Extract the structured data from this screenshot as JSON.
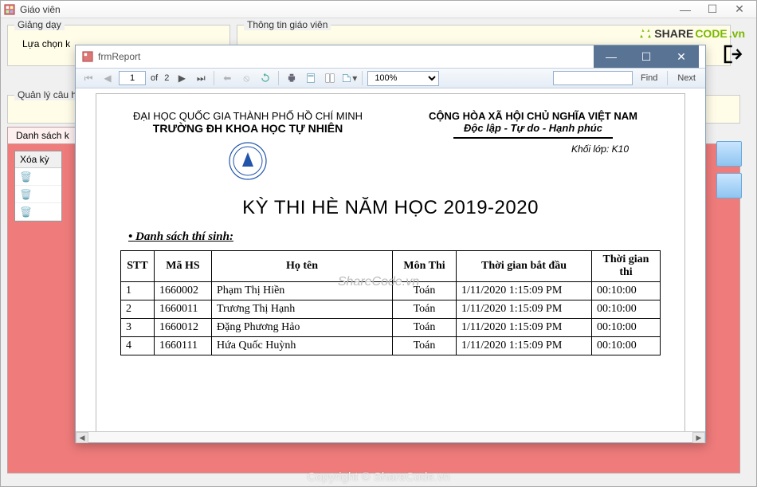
{
  "main": {
    "title": "Giáo viên",
    "group1_legend": "Giảng dạy",
    "group1_label": "Lựa chọn k",
    "group2_legend": "Thông tin giáo viên",
    "group3_legend": "Quản lý câu h",
    "tab_label": "Danh sách k",
    "grid_header": "Xóa kỳ"
  },
  "modal": {
    "title": "frmReport",
    "page_current": "1",
    "page_of": "of",
    "page_total": "2",
    "zoom": "100%",
    "find_placeholder": "",
    "find_label": "Find",
    "next_label": "Next"
  },
  "report": {
    "hdr_left_1": "ĐẠI HỌC QUỐC GIA THÀNH PHỐ HỒ CHÍ MINH",
    "hdr_left_2": "TRƯỜNG ĐH KHOA HỌC TỰ NHIÊN",
    "hdr_right_1": "CỘNG HÒA XÃ HỘI CHỦ NGHĨA VIỆT NAM",
    "hdr_right_2": "Độc lập - Tự do - Hạnh phúc",
    "hdr_right_3_label": "Khối lớp:",
    "hdr_right_3_val": "K10",
    "title": "KỲ THI HÈ NĂM HỌC 2019-2020",
    "section": "Danh sách thí sinh:",
    "th": {
      "stt": "STT",
      "mahs": "Mã HS",
      "hoten": "Họ tên",
      "monthi": "Môn Thi",
      "start": "Thời gian bắt đầu",
      "dur": "Thời gian thi"
    },
    "rows": [
      {
        "stt": "1",
        "mahs": "1660002",
        "hoten": "Phạm Thị Hiền",
        "monthi": "Toán",
        "start": "1/11/2020 1:15:09 PM",
        "dur": "00:10:00"
      },
      {
        "stt": "2",
        "mahs": "1660011",
        "hoten": "Trương Thị Hạnh",
        "monthi": "Toán",
        "start": "1/11/2020 1:15:09 PM",
        "dur": "00:10:00"
      },
      {
        "stt": "3",
        "mahs": "1660012",
        "hoten": "Đặng Phương Hảo",
        "monthi": "Toán",
        "start": "1/11/2020 1:15:09 PM",
        "dur": "00:10:00"
      },
      {
        "stt": "4",
        "mahs": "1660111",
        "hoten": "Hứa Quốc Huỳnh",
        "monthi": "Toán",
        "start": "1/11/2020 1:15:09 PM",
        "dur": "00:10:00"
      }
    ]
  },
  "branding": {
    "logo_text_1": "SHARE",
    "logo_text_2": "CODE",
    "logo_text_3": ".vn",
    "watermark": "ShareCode.vn",
    "copyright": "Copyright © ShareCode.vn"
  }
}
